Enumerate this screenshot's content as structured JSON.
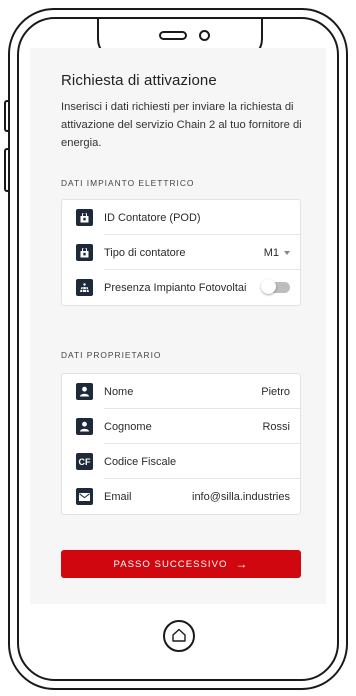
{
  "page": {
    "title": "Richiesta di attivazione",
    "description": "Inserisci i dati richiesti per inviare la richiesta di attivazione del servizio Chain 2 al tuo fornitore di energia."
  },
  "impianto": {
    "section_title": "Dati impianto elettrico",
    "rows": [
      {
        "label": "ID Contatore (POD)",
        "value": "",
        "icon": "meter-icon"
      },
      {
        "label": "Tipo di contatore",
        "value": "M1",
        "icon": "meter-icon"
      },
      {
        "label": "Presenza Impianto Fotovoltai",
        "value": "",
        "icon": "solar-panel-icon",
        "toggle": "off"
      }
    ]
  },
  "proprietario": {
    "section_title": "Dati proprietario",
    "rows": [
      {
        "label": "Nome",
        "value": "Pietro",
        "icon": "user-icon"
      },
      {
        "label": "Cognome",
        "value": "Rossi",
        "icon": "user-icon"
      },
      {
        "label": "Codice Fiscale",
        "value": "",
        "icon": "cf-icon",
        "icon_text": "CF"
      },
      {
        "label": "Email",
        "value": "info@silla.industries",
        "icon": "mail-icon"
      }
    ]
  },
  "cta": {
    "label": "PASSO SUCCESSIVO",
    "arrow": "→"
  },
  "colors": {
    "accent": "#d0070f",
    "icon_bg": "#1e2a3a",
    "screen_bg": "#f6f6f7"
  }
}
